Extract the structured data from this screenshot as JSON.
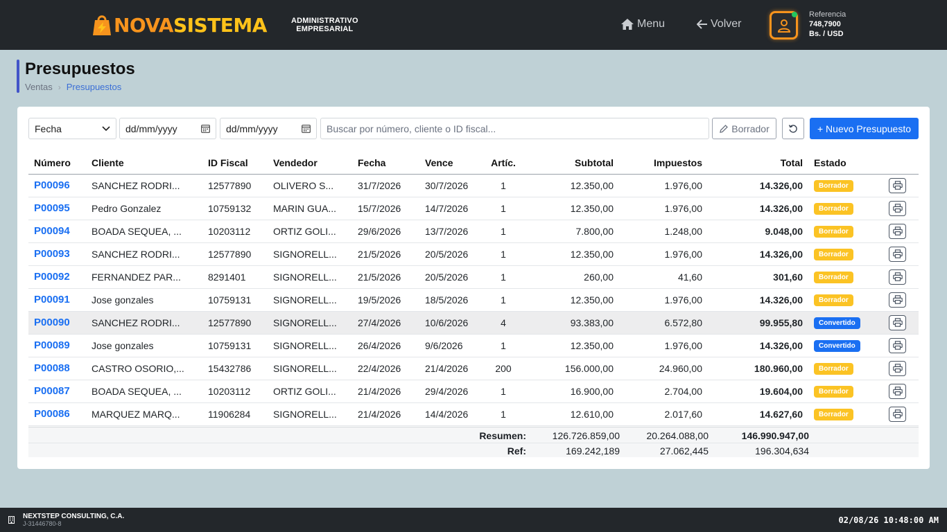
{
  "header": {
    "brand_part1": "NOVA",
    "brand_part2": "SISTEMA",
    "subtitle_line1": "ADMINISTRATIVO",
    "subtitle_line2": "EMPRESARIAL",
    "menu_label": "Menu",
    "back_label": "Volver",
    "reference_label": "Referencia",
    "reference_rate": "748,7900",
    "reference_unit": "Bs. / USD",
    "colors": {
      "brand_orange": "#f7941d",
      "brand_yellow": "#ffc21a",
      "status_online": "#22c55e"
    },
    "icons": {
      "menu": "home-icon",
      "back": "arrow-left-icon",
      "user": "user-icon"
    }
  },
  "page": {
    "title": "Presupuestos",
    "breadcrumb": [
      "Ventas",
      "Presupuestos"
    ]
  },
  "filters": {
    "date_field": "Fecha",
    "date_from_placeholder": "dd/mm/yyyy",
    "date_to_placeholder": "dd/mm/yyyy",
    "search_placeholder": "Buscar por número, cliente o ID fiscal...",
    "draft_button": "Borrador",
    "new_button": "+ Nuevo Presupuesto",
    "accent_color": "#1a6ff2"
  },
  "table": {
    "columns": [
      "Número",
      "Cliente",
      "ID Fiscal",
      "Vendedor",
      "Fecha",
      "Vence",
      "Artíc.",
      "Subtotal",
      "Impuestos",
      "Total",
      "Estado"
    ],
    "rows": [
      {
        "numero": "P00096",
        "cliente": "SANCHEZ RODRI...",
        "id_fiscal": "12577890",
        "vendedor": "OLIVERO S...",
        "fecha": "31/7/2026",
        "vence": "30/7/2026",
        "artic": "1",
        "subtotal": "12.350,00",
        "impuestos": "1.976,00",
        "total": "14.326,00",
        "estado": "Borrador",
        "estado_key": "borrador"
      },
      {
        "numero": "P00095",
        "cliente": "Pedro Gonzalez",
        "id_fiscal": "10759132",
        "vendedor": "MARIN GUA...",
        "fecha": "15/7/2026",
        "vence": "14/7/2026",
        "artic": "1",
        "subtotal": "12.350,00",
        "impuestos": "1.976,00",
        "total": "14.326,00",
        "estado": "Borrador",
        "estado_key": "borrador"
      },
      {
        "numero": "P00094",
        "cliente": "BOADA SEQUEA, ...",
        "id_fiscal": "10203112",
        "vendedor": "ORTIZ GOLI...",
        "fecha": "29/6/2026",
        "vence": "13/7/2026",
        "artic": "1",
        "subtotal": "7.800,00",
        "impuestos": "1.248,00",
        "total": "9.048,00",
        "estado": "Borrador",
        "estado_key": "borrador"
      },
      {
        "numero": "P00093",
        "cliente": "SANCHEZ RODRI...",
        "id_fiscal": "12577890",
        "vendedor": "SIGNORELL...",
        "fecha": "21/5/2026",
        "vence": "20/5/2026",
        "artic": "1",
        "subtotal": "12.350,00",
        "impuestos": "1.976,00",
        "total": "14.326,00",
        "estado": "Borrador",
        "estado_key": "borrador"
      },
      {
        "numero": "P00092",
        "cliente": "FERNANDEZ PAR...",
        "id_fiscal": "8291401",
        "vendedor": "SIGNORELL...",
        "fecha": "21/5/2026",
        "vence": "20/5/2026",
        "artic": "1",
        "subtotal": "260,00",
        "impuestos": "41,60",
        "total": "301,60",
        "estado": "Borrador",
        "estado_key": "borrador"
      },
      {
        "numero": "P00091",
        "cliente": "Jose gonzales",
        "id_fiscal": "10759131",
        "vendedor": "SIGNORELL...",
        "fecha": "19/5/2026",
        "vence": "18/5/2026",
        "artic": "1",
        "subtotal": "12.350,00",
        "impuestos": "1.976,00",
        "total": "14.326,00",
        "estado": "Borrador",
        "estado_key": "borrador"
      },
      {
        "numero": "P00090",
        "cliente": "SANCHEZ RODRI...",
        "id_fiscal": "12577890",
        "vendedor": "SIGNORELL...",
        "fecha": "27/4/2026",
        "vence": "10/6/2026",
        "artic": "4",
        "subtotal": "93.383,00",
        "impuestos": "6.572,80",
        "total": "99.955,80",
        "estado": "Convertido",
        "estado_key": "convertido",
        "highlight": true
      },
      {
        "numero": "P00089",
        "cliente": "Jose gonzales",
        "id_fiscal": "10759131",
        "vendedor": "SIGNORELL...",
        "fecha": "26/4/2026",
        "vence": "9/6/2026",
        "artic": "1",
        "subtotal": "12.350,00",
        "impuestos": "1.976,00",
        "total": "14.326,00",
        "estado": "Convertido",
        "estado_key": "convertido"
      },
      {
        "numero": "P00088",
        "cliente": "CASTRO OSORIO,...",
        "id_fiscal": "15432786",
        "vendedor": "SIGNORELL...",
        "fecha": "22/4/2026",
        "vence": "21/4/2026",
        "artic": "200",
        "subtotal": "156.000,00",
        "impuestos": "24.960,00",
        "total": "180.960,00",
        "estado": "Borrador",
        "estado_key": "borrador"
      },
      {
        "numero": "P00087",
        "cliente": "BOADA SEQUEA, ...",
        "id_fiscal": "10203112",
        "vendedor": "ORTIZ GOLI...",
        "fecha": "21/4/2026",
        "vence": "29/4/2026",
        "artic": "1",
        "subtotal": "16.900,00",
        "impuestos": "2.704,00",
        "total": "19.604,00",
        "estado": "Borrador",
        "estado_key": "borrador"
      },
      {
        "numero": "P00086",
        "cliente": "MARQUEZ MARQ...",
        "id_fiscal": "11906284",
        "vendedor": "SIGNORELL...",
        "fecha": "21/4/2026",
        "vence": "14/4/2026",
        "artic": "1",
        "subtotal": "12.610,00",
        "impuestos": "2.017,60",
        "total": "14.627,60",
        "estado": "Borrador",
        "estado_key": "borrador"
      }
    ],
    "status_colors": {
      "borrador": "#fbc324",
      "convertido": "#1a6ff2"
    }
  },
  "summary": {
    "label": "Resumen:",
    "subtotal": "126.726.859,00",
    "impuestos": "20.264.088,00",
    "total": "146.990.947,00",
    "ref_label": "Ref:",
    "ref_subtotal": "169.242,189",
    "ref_impuestos": "27.062,445",
    "ref_total": "196.304,634"
  },
  "footer": {
    "company": "NEXTSTEP CONSULTING, C.A.",
    "rif": "J-31446780-8",
    "clock": "02/08/26 10:48:00 AM",
    "icon": "building-icon"
  }
}
